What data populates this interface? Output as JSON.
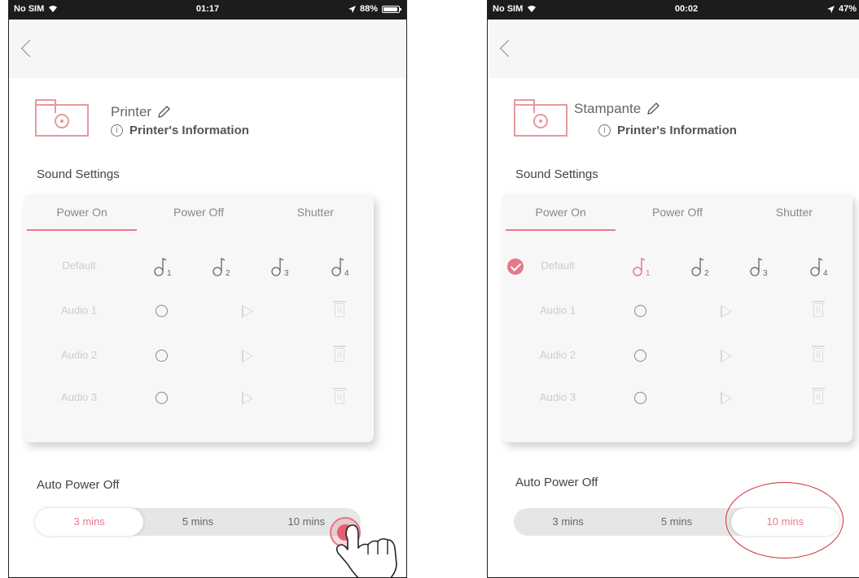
{
  "colors": {
    "accent": "#e77b8b",
    "printer_icon": "#e49a9e",
    "highlight": "#d42b35"
  },
  "left": {
    "status": {
      "carrier": "No SIM",
      "time": "01:17",
      "battery": "88%",
      "battery_level": 0.88
    },
    "printer": {
      "name": "Printer",
      "info": "Printer's Information"
    },
    "sound_settings": {
      "title": "Sound Settings",
      "tabs": [
        "Power On",
        "Power Off",
        "Shutter"
      ],
      "active_tab": 0,
      "rows": [
        {
          "label": "Default",
          "sounds": [
            "1",
            "2",
            "3",
            "4"
          ]
        },
        {
          "label": "Audio 1"
        },
        {
          "label": "Audio 2"
        },
        {
          "label": "Audio 3"
        }
      ]
    },
    "auto_power_off": {
      "title": "Auto Power Off",
      "options": [
        "3 mins",
        "5 mins",
        "10 mins"
      ],
      "selected": 0
    }
  },
  "right": {
    "status": {
      "carrier": "No SIM",
      "time": "00:02",
      "battery": "47%",
      "battery_level": 0.47
    },
    "printer": {
      "name": "Stampante",
      "info": "Printer's Information"
    },
    "sound_settings": {
      "title": "Sound Settings",
      "tabs": [
        "Power On",
        "Power Off",
        "Shutter"
      ],
      "active_tab": 0,
      "rows": [
        {
          "label": "Default",
          "sounds": [
            "1",
            "2",
            "3",
            "4"
          ],
          "selected_sound": 0
        },
        {
          "label": "Audio 1"
        },
        {
          "label": "Audio 2"
        },
        {
          "label": "Audio 3"
        }
      ]
    },
    "auto_power_off": {
      "title": "Auto Power Off",
      "options": [
        "3 mins",
        "5 mins",
        "10 mins"
      ],
      "selected": 2
    }
  }
}
